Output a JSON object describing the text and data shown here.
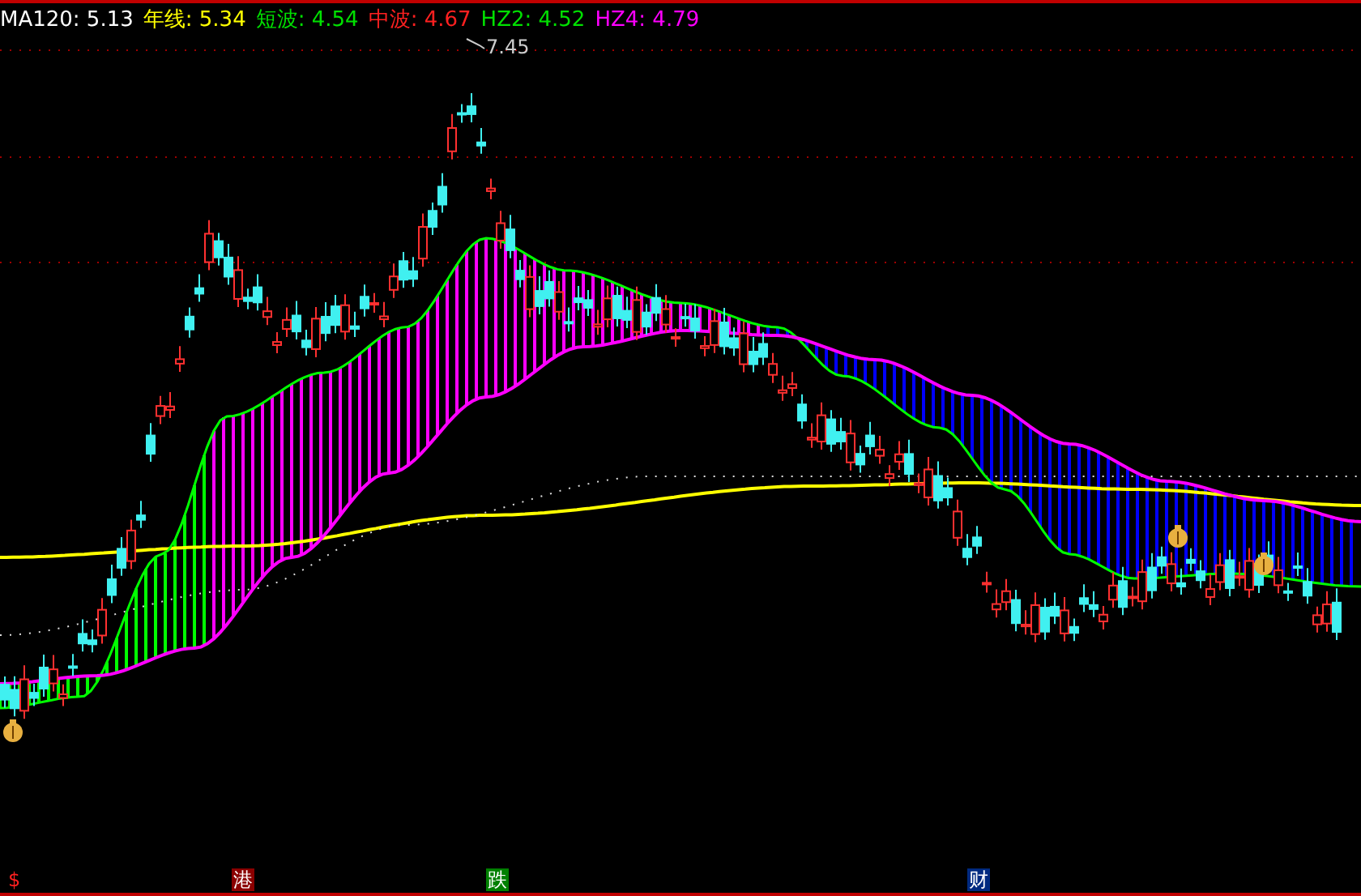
{
  "indicators": [
    {
      "label": "MA120:",
      "value": "5.13",
      "color": "#ffffff"
    },
    {
      "label": "年线:",
      "value": "5.34",
      "color": "#ffff00"
    },
    {
      "label": "短波:",
      "value": "4.54",
      "color": "#00e000"
    },
    {
      "label": "中波:",
      "value": "4.67",
      "color": "#ff2020"
    },
    {
      "label": "HZ2:",
      "value": "4.52",
      "color": "#00e000"
    },
    {
      "label": "HZ4:",
      "value": "4.79",
      "color": "#ff00ff"
    }
  ],
  "peak_label": "7.45",
  "event_markers": [
    {
      "text": "$",
      "color": "#000000"
    },
    {
      "text": "港",
      "color": "#8b0000"
    },
    {
      "text": "跌",
      "color": "#008000"
    },
    {
      "text": "财",
      "color": "#002a80"
    }
  ]
}
